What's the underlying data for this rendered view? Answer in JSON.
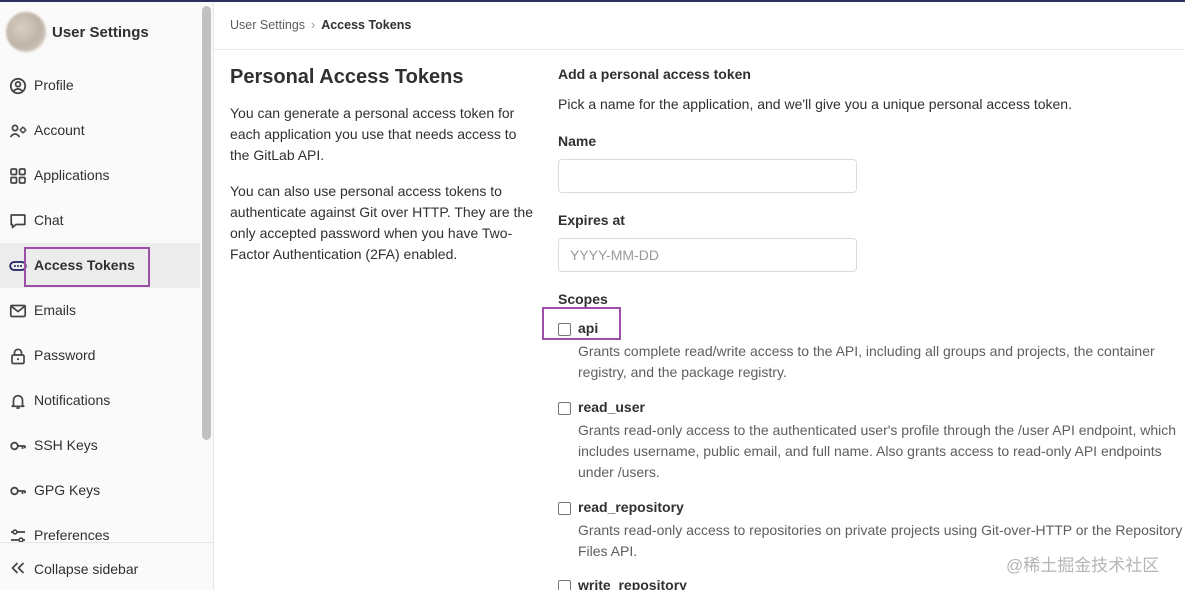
{
  "sidebar": {
    "title": "User Settings",
    "items": [
      {
        "label": "Profile",
        "icon": "profile-icon"
      },
      {
        "label": "Account",
        "icon": "account-icon"
      },
      {
        "label": "Applications",
        "icon": "applications-icon"
      },
      {
        "label": "Chat",
        "icon": "chat-icon"
      },
      {
        "label": "Access Tokens",
        "icon": "token-icon",
        "active": true
      },
      {
        "label": "Emails",
        "icon": "mail-icon"
      },
      {
        "label": "Password",
        "icon": "lock-icon"
      },
      {
        "label": "Notifications",
        "icon": "bell-icon"
      },
      {
        "label": "SSH Keys",
        "icon": "key-icon"
      },
      {
        "label": "GPG Keys",
        "icon": "key-icon"
      },
      {
        "label": "Preferences",
        "icon": "preferences-icon"
      }
    ],
    "collapse_label": "Collapse sidebar"
  },
  "breadcrumb": {
    "parent": "User Settings",
    "current": "Access Tokens"
  },
  "intro": {
    "title": "Personal Access Tokens",
    "paragraph1": "You can generate a personal access token for each application you use that needs access to the GitLab API.",
    "paragraph2": "You can also use personal access tokens to authenticate against Git over HTTP. They are the only accepted password when you have Two-Factor Authentication (2FA) enabled."
  },
  "form": {
    "heading": "Add a personal access token",
    "subheading": "Pick a name for the application, and we'll give you a unique personal access token.",
    "name_label": "Name",
    "name_value": "",
    "expires_label": "Expires at",
    "expires_placeholder": "YYYY-MM-DD",
    "scopes_label": "Scopes",
    "scopes": [
      {
        "name": "api",
        "checked": false,
        "description": "Grants complete read/write access to the API, including all groups and projects, the container registry, and the package registry."
      },
      {
        "name": "read_user",
        "checked": false,
        "description": "Grants read-only access to the authenticated user's profile through the /user API endpoint, which includes username, public email, and full name. Also grants access to read-only API endpoints under /users."
      },
      {
        "name": "read_repository",
        "checked": false,
        "description": "Grants read-only access to repositories on private projects using Git-over-HTTP or the Repository Files API."
      },
      {
        "name": "write_repository",
        "checked": false,
        "description": ""
      }
    ]
  },
  "watermark": "@稀土掘金技术社区",
  "colors": {
    "highlight": "#9b4fa6",
    "active_bg": "#ececec",
    "topline": "#2e2e5e"
  }
}
